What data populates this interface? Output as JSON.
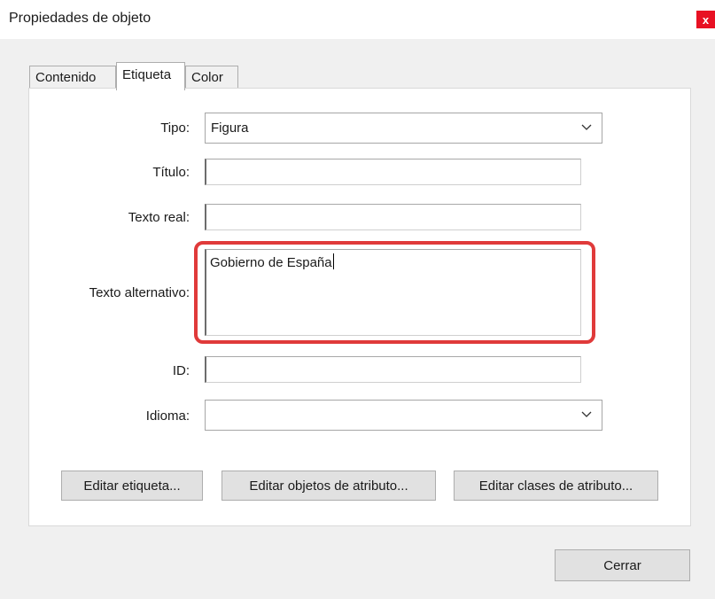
{
  "dialog": {
    "title": "Propiedades de objeto",
    "close_label": "x"
  },
  "tabs": [
    {
      "label": "Contenido"
    },
    {
      "label": "Etiqueta"
    },
    {
      "label": "Color"
    }
  ],
  "form": {
    "tipo_label": "Tipo:",
    "tipo_value": "Figura",
    "titulo_label": "Título:",
    "titulo_value": "",
    "texto_real_label": "Texto real:",
    "texto_real_value": "",
    "texto_alt_label": "Texto alternativo:",
    "texto_alt_value": "Gobierno de España",
    "id_label": "ID:",
    "id_value": "",
    "idioma_label": "Idioma:",
    "idioma_value": ""
  },
  "buttons": {
    "editar_etiqueta": "Editar etiqueta...",
    "editar_objetos": "Editar objetos de atributo...",
    "editar_clases": "Editar clases de atributo...",
    "cerrar": "Cerrar"
  },
  "colors": {
    "highlight": "#e03a3a",
    "close_bg": "#e81123"
  }
}
